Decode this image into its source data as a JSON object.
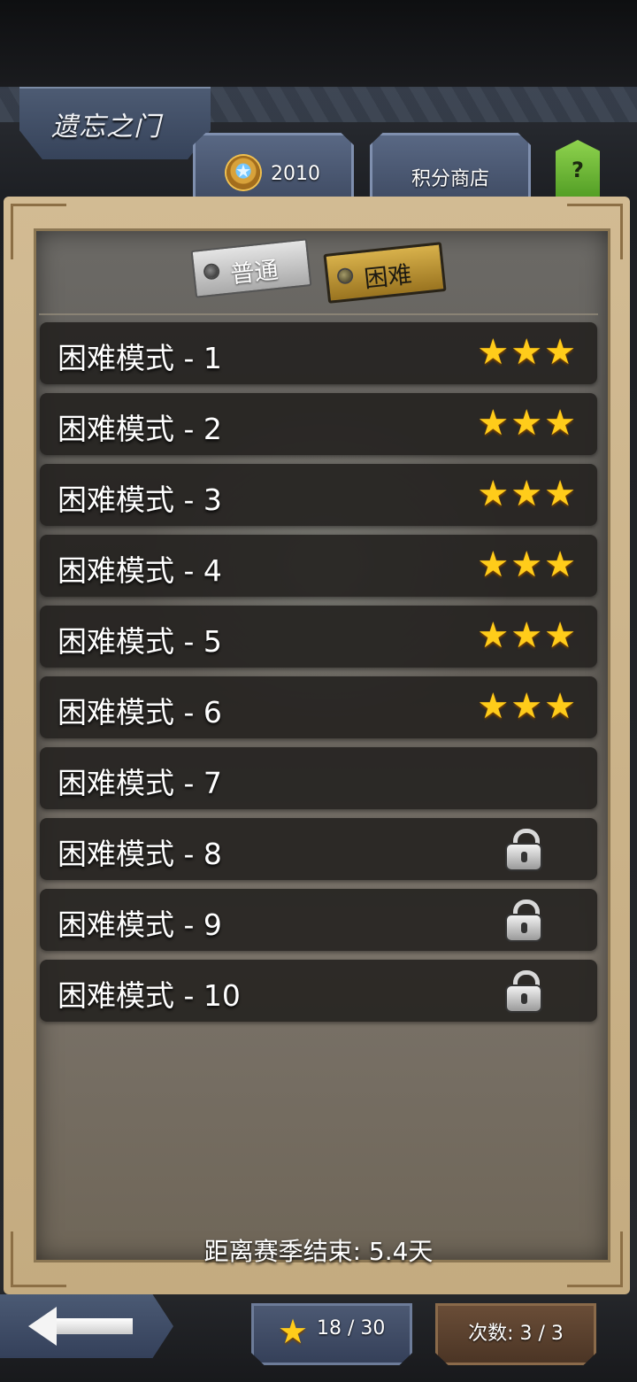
{
  "header": {
    "title": "遗忘之门",
    "points_value": "2010",
    "shop_label": "积分商店",
    "help_label": "?"
  },
  "modes": {
    "normal_label": "普通",
    "hard_label": "困难",
    "selected": "困难"
  },
  "levels": [
    {
      "name": "困难模式 - 1",
      "stars": 3,
      "locked": false
    },
    {
      "name": "困难模式 - 2",
      "stars": 3,
      "locked": false
    },
    {
      "name": "困难模式 - 3",
      "stars": 3,
      "locked": false
    },
    {
      "name": "困难模式 - 4",
      "stars": 3,
      "locked": false
    },
    {
      "name": "困难模式 - 5",
      "stars": 3,
      "locked": false
    },
    {
      "name": "困难模式 - 6",
      "stars": 3,
      "locked": false
    },
    {
      "name": "困难模式 - 7",
      "stars": 0,
      "locked": false
    },
    {
      "name": "困难模式 - 8",
      "stars": 0,
      "locked": true
    },
    {
      "name": "困难模式 - 9",
      "stars": 0,
      "locked": true
    },
    {
      "name": "困难模式 - 10",
      "stars": 0,
      "locked": true
    }
  ],
  "season_remaining": "距离赛季结束: 5.4天",
  "footer": {
    "stars_progress": "18 / 30",
    "attempts": "次数: 3 / 3"
  },
  "colors": {
    "star": "#ffcc1a",
    "hard_tab": "#d8b14b",
    "help_button": "#8fd34e",
    "panel_frame": "#d2bb93"
  }
}
